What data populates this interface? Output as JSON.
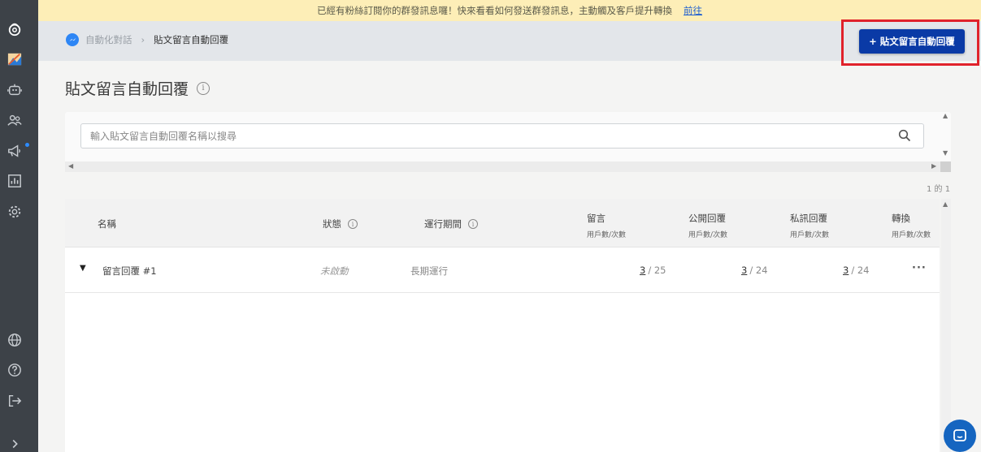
{
  "banner": {
    "text": "已經有粉絲訂閱你的群發訊息囉！快來看看如何發送群發訊息，主動觸及客戶提升轉換",
    "link": "前往"
  },
  "breadcrumb": {
    "parent": "自動化對話",
    "separator": "›",
    "current": "貼文留言自動回覆"
  },
  "header": {
    "primary_button": "+ 貼文留言自動回覆"
  },
  "page": {
    "title": "貼文留言自動回覆"
  },
  "search": {
    "placeholder": "輸入貼文留言自動回覆名稱以搜尋"
  },
  "pagination": {
    "text": "1 的 1"
  },
  "table": {
    "columns": {
      "name": "名稱",
      "status": "狀態",
      "period": "運行期間",
      "comments": "留言",
      "comments_sub": "用戶數/次數",
      "public_reply": "公開回覆",
      "public_reply_sub": "用戶數/次數",
      "private_reply": "私訊回覆",
      "private_reply_sub": "用戶數/次數",
      "conversion": "轉換",
      "conversion_sub": "用戶數/次數"
    },
    "rows": [
      {
        "name": "留言回覆 #1",
        "status": "未啟動",
        "period": "長期運行",
        "comments_users": "3",
        "comments_count": "/ 25",
        "public_users": "3",
        "public_count": "/ 24",
        "private_users": "3",
        "private_count": "/ 24",
        "more": "···"
      }
    ]
  },
  "icons": {
    "sidebar": [
      "logo-icon",
      "image-icon",
      "bot-icon",
      "users-icon",
      "megaphone-icon",
      "chart-icon",
      "gear-icon",
      "globe-icon",
      "help-icon",
      "logout-icon",
      "expand-icon"
    ]
  },
  "colors": {
    "primary": "#0a3aa6",
    "banner": "#fdeeb7",
    "sidebar": "#3d4248",
    "highlight": "#e0222b"
  }
}
